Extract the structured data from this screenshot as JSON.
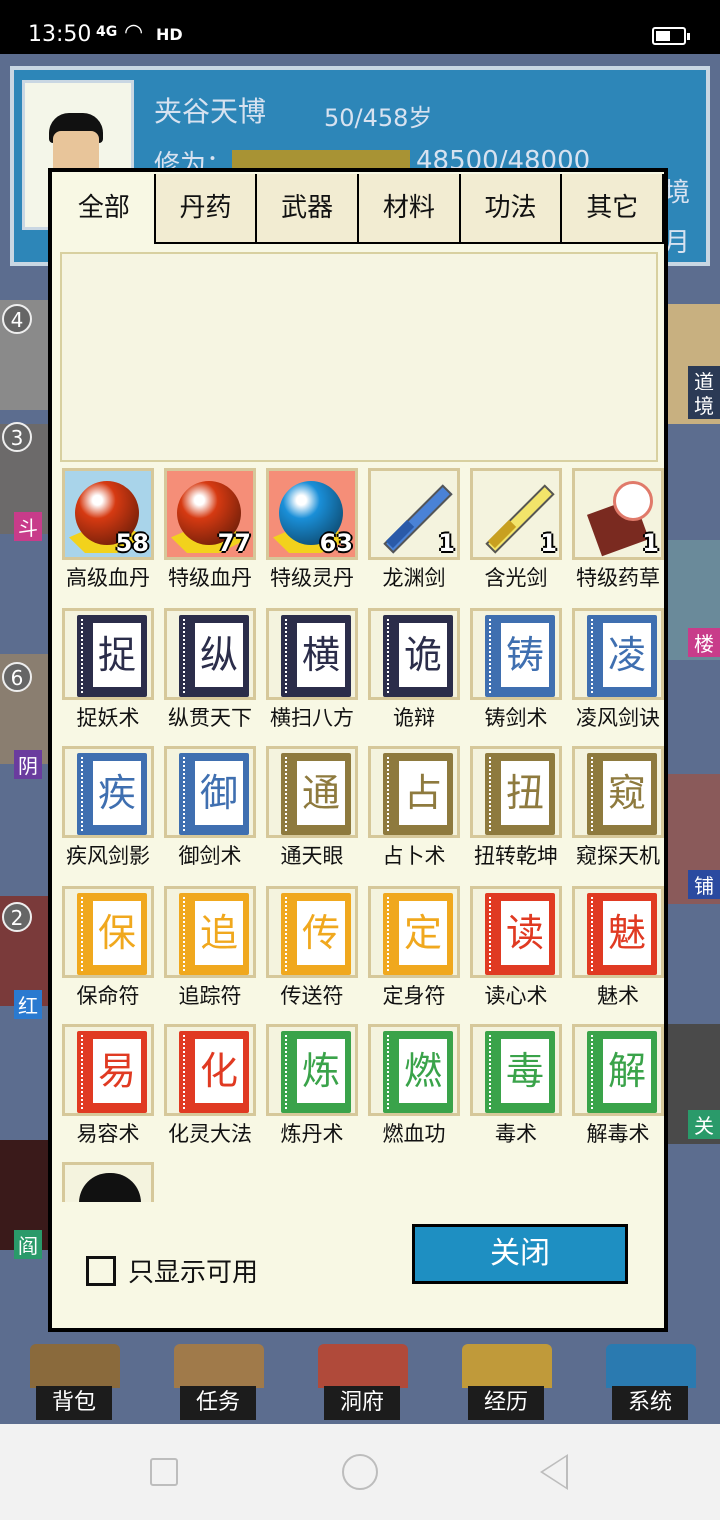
{
  "status_bar": {
    "time": "13:50",
    "network": "4G",
    "hd": "HD",
    "battery_level": 0.55
  },
  "character": {
    "name": "夹谷天博",
    "age": "50/458岁",
    "cultivation_label": "修为：",
    "cultivation_value": "48500/48000",
    "cultivation_fill": 1.0,
    "side_text_1": "境",
    "side_text_2": "月"
  },
  "background": {
    "badges": [
      "4",
      "3",
      "6",
      "2"
    ],
    "left_tags": [
      "斗",
      "阴",
      "红",
      "阎"
    ],
    "right_tags": [
      "道",
      "境",
      "楼",
      "铺",
      "关"
    ]
  },
  "bottom_nav": [
    "背包",
    "任务",
    "洞府",
    "经历",
    "系统"
  ],
  "dialog": {
    "tabs": [
      "全部",
      "丹药",
      "武器",
      "材料",
      "功法",
      "其它"
    ],
    "active_tab": 0,
    "items": [
      {
        "name": "高级血丹",
        "count": "58",
        "kind": "pill",
        "bg": "#a9d4ea",
        "color": "#d63a12"
      },
      {
        "name": "特级血丹",
        "count": "77",
        "kind": "pill",
        "bg": "#f58e78",
        "color": "#d63a12"
      },
      {
        "name": "特级灵丹",
        "count": "63",
        "kind": "pill",
        "bg": "#f58e78",
        "color": "#1a8fd8"
      },
      {
        "name": "龙渊剑",
        "count": "1",
        "kind": "sword",
        "bg": "#f4f3de",
        "color": "#4a82d6"
      },
      {
        "name": "含光剑",
        "count": "1",
        "kind": "sword",
        "bg": "#f4f3de",
        "color": "#f2e46a"
      },
      {
        "name": "特级药草",
        "count": "1",
        "kind": "herb",
        "bg": "#f4f3de",
        "color": "#7a2a20"
      },
      {
        "name": "捉妖术",
        "char": "捉",
        "kind": "book",
        "bg": "#f4f3de",
        "color": "#2b2d4a"
      },
      {
        "name": "纵贯天下",
        "char": "纵",
        "kind": "book",
        "bg": "#f4f3de",
        "color": "#2b2d4a"
      },
      {
        "name": "横扫八方",
        "char": "横",
        "kind": "book",
        "bg": "#f4f3de",
        "color": "#2b2d4a"
      },
      {
        "name": "诡辩",
        "char": "诡",
        "kind": "book",
        "bg": "#f4f3de",
        "color": "#2b2d4a"
      },
      {
        "name": "铸剑术",
        "char": "铸",
        "kind": "book",
        "bg": "#f4f3de",
        "color": "#3f6fb0"
      },
      {
        "name": "凌风剑诀",
        "char": "凌",
        "kind": "book",
        "bg": "#f4f3de",
        "color": "#3f6fb0"
      },
      {
        "name": "疾风剑影",
        "char": "疾",
        "kind": "book",
        "bg": "#f4f3de",
        "color": "#3f6fb0"
      },
      {
        "name": "御剑术",
        "char": "御",
        "kind": "book",
        "bg": "#f4f3de",
        "color": "#3f6fb0"
      },
      {
        "name": "通天眼",
        "char": "通",
        "kind": "book",
        "bg": "#f4f3de",
        "color": "#8e7a3e"
      },
      {
        "name": "占卜术",
        "char": "占",
        "kind": "book",
        "bg": "#f4f3de",
        "color": "#8e7a3e"
      },
      {
        "name": "扭转乾坤",
        "char": "扭",
        "kind": "book",
        "bg": "#f4f3de",
        "color": "#8e7a3e"
      },
      {
        "name": "窥探天机",
        "char": "窥",
        "kind": "book",
        "bg": "#f4f3de",
        "color": "#8e7a3e"
      },
      {
        "name": "保命符",
        "char": "保",
        "kind": "book",
        "bg": "#f4f3de",
        "color": "#f0a81e"
      },
      {
        "name": "追踪符",
        "char": "追",
        "kind": "book",
        "bg": "#f4f3de",
        "color": "#f0a81e"
      },
      {
        "name": "传送符",
        "char": "传",
        "kind": "book",
        "bg": "#f4f3de",
        "color": "#f0a81e"
      },
      {
        "name": "定身符",
        "char": "定",
        "kind": "book",
        "bg": "#f4f3de",
        "color": "#f0a81e"
      },
      {
        "name": "读心术",
        "char": "读",
        "kind": "book",
        "bg": "#f4f3de",
        "color": "#e03a22"
      },
      {
        "name": "魅术",
        "char": "魅",
        "kind": "book",
        "bg": "#f4f3de",
        "color": "#e03a22"
      },
      {
        "name": "易容术",
        "char": "易",
        "kind": "book",
        "bg": "#f4f3de",
        "color": "#e03a22"
      },
      {
        "name": "化灵大法",
        "char": "化",
        "kind": "book",
        "bg": "#f4f3de",
        "color": "#e03a22"
      },
      {
        "name": "炼丹术",
        "char": "炼",
        "kind": "book",
        "bg": "#f4f3de",
        "color": "#3aa34a"
      },
      {
        "name": "燃血功",
        "char": "燃",
        "kind": "book",
        "bg": "#f4f3de",
        "color": "#3aa34a"
      },
      {
        "name": "毒术",
        "char": "毒",
        "kind": "book",
        "bg": "#f4f3de",
        "color": "#3aa34a"
      },
      {
        "name": "解毒术",
        "char": "解",
        "kind": "book",
        "bg": "#f4f3de",
        "color": "#3aa34a"
      }
    ],
    "only_available_label": "只显示可用",
    "only_available_checked": false,
    "close_label": "关闭"
  }
}
